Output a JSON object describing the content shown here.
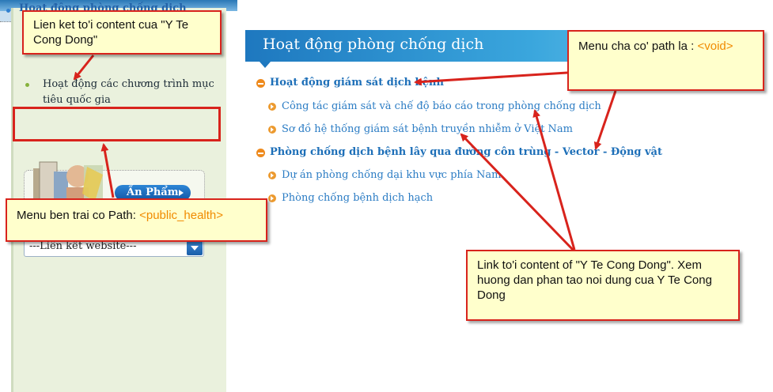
{
  "left_menu": {
    "items": [
      {
        "label": "Hoạt động các chương trình mục tiêu quốc gia"
      },
      {
        "label": "Hoạt động phòng chống dịch"
      }
    ],
    "publications_button": "Ấn Phẩm",
    "links_select": {
      "value": "---Liên kết website---"
    }
  },
  "main": {
    "title": "Hoạt động phòng chống dịch",
    "categories": [
      {
        "label": "Hoạt động giám sát dịch bệnh",
        "items": [
          "Công tác giám sát và chế độ báo cáo trong phòng chống dịch",
          "Sơ đồ hệ thống giám sát bệnh truyền nhiễm ở Việt Nam"
        ]
      },
      {
        "label": "Phòng chống dịch bệnh lây qua đường côn trùng - Vector - Động vật",
        "items": [
          "Dự án phòng chống dại khu vực phía Nam",
          "Phòng chống bệnh dịch hạch"
        ]
      }
    ]
  },
  "annotations": {
    "note1": {
      "text": "Lien ket to'i content cua \"Y Te Cong Dong\""
    },
    "note2": {
      "text": "Menu ben trai co Path: ",
      "highlight": "<public_health>"
    },
    "note3": {
      "text": "Menu cha co' path la : ",
      "highlight": "<void>"
    },
    "note4": {
      "text": "Link to'i content of \"Y Te Cong Dong\". Xem huong dan phan tao noi dung cua Y Te Cong Dong"
    }
  },
  "colors": {
    "accent": "#d8231c",
    "link": "#2b7cc4",
    "highlight": "#f08a00"
  },
  "icons": [
    "bullet-icon",
    "minus-circle-icon",
    "arrow-circle-icon",
    "chevron-down-icon",
    "play-icon"
  ]
}
